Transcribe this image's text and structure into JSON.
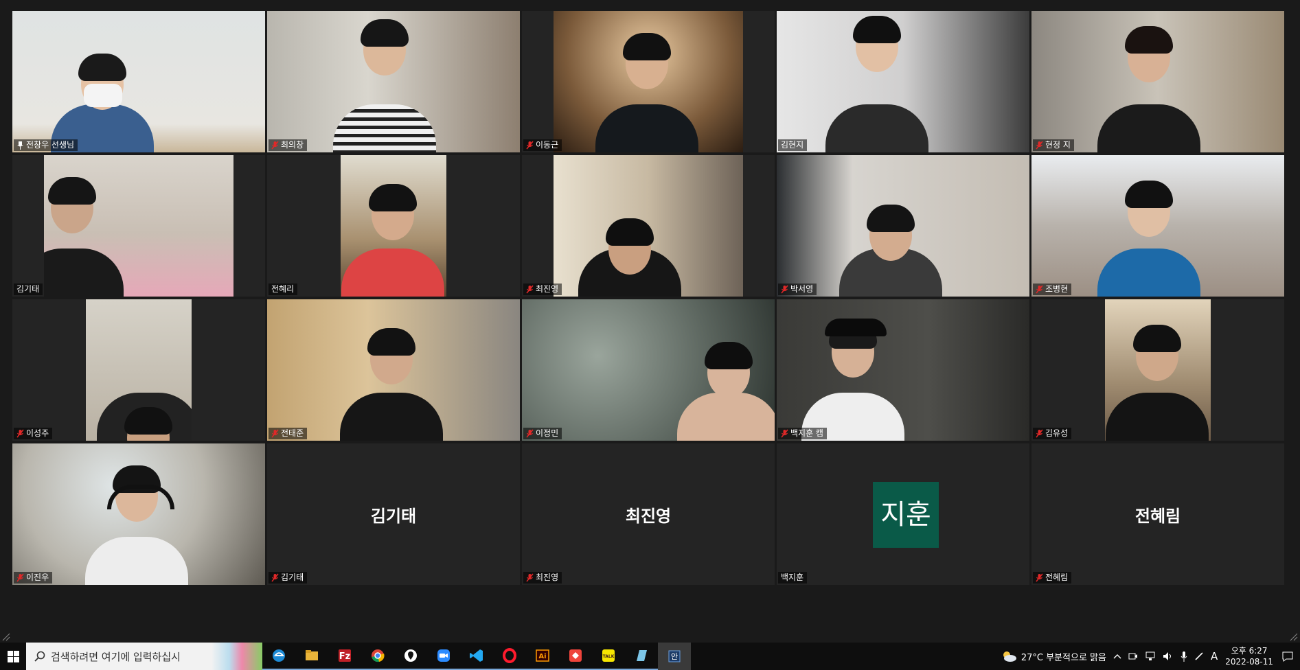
{
  "participants": [
    {
      "name": "전창우 선생님",
      "mic": "pinned",
      "tile": "video",
      "active": true
    },
    {
      "name": "최의창",
      "mic": "muted",
      "tile": "video"
    },
    {
      "name": "이동근",
      "mic": "muted",
      "tile": "video"
    },
    {
      "name": "김현지",
      "mic": "none",
      "tile": "video"
    },
    {
      "name": "현정 지",
      "mic": "muted",
      "tile": "video"
    },
    {
      "name": "김기태",
      "mic": "none",
      "tile": "video"
    },
    {
      "name": "전혜리",
      "mic": "none",
      "tile": "video"
    },
    {
      "name": "최진영",
      "mic": "muted",
      "tile": "video"
    },
    {
      "name": "박서영",
      "mic": "muted",
      "tile": "video"
    },
    {
      "name": "조병현",
      "mic": "muted",
      "tile": "video"
    },
    {
      "name": "이성주",
      "mic": "muted",
      "tile": "video"
    },
    {
      "name": "전태준",
      "mic": "muted",
      "tile": "video"
    },
    {
      "name": "이정민",
      "mic": "muted",
      "tile": "video"
    },
    {
      "name": "백지훈 캠",
      "mic": "muted",
      "tile": "video"
    },
    {
      "name": "김유성",
      "mic": "muted",
      "tile": "video"
    },
    {
      "name": "이진우",
      "mic": "muted",
      "tile": "video"
    },
    {
      "name": "김기태",
      "mic": "muted",
      "tile": "name",
      "display": "김기태"
    },
    {
      "name": "최진영",
      "mic": "muted",
      "tile": "name",
      "display": "최진영"
    },
    {
      "name": "백지훈",
      "mic": "none",
      "tile": "avatar",
      "display": "지훈"
    },
    {
      "name": "전혜림",
      "mic": "muted",
      "tile": "name",
      "display": "전혜림"
    }
  ],
  "taskbar": {
    "search_placeholder": "검색하려면 여기에 입력하십시",
    "apps": [
      {
        "icon": "edge-icon"
      },
      {
        "icon": "file-explorer-icon"
      },
      {
        "icon": "filezilla-icon"
      },
      {
        "icon": "chrome-icon"
      },
      {
        "icon": "maps-pin-icon"
      },
      {
        "icon": "zoom-icon"
      },
      {
        "icon": "vscode-icon"
      },
      {
        "icon": "opera-icon"
      },
      {
        "icon": "illustrator-icon"
      },
      {
        "icon": "anydesk-icon"
      },
      {
        "icon": "kakaotalk-icon"
      },
      {
        "icon": "notes-icon"
      },
      {
        "icon": "ime-icon"
      }
    ],
    "ai_label": "Ai",
    "talk_label": "TALK",
    "ime_label": "안"
  },
  "tray": {
    "weather": "27°C  부분적으로 맑음",
    "ime_mode": "A",
    "time": "오후 6:27",
    "date": "2022-08-11"
  },
  "colors": {
    "stage_bg": "#1a1a1a",
    "tile_bg": "#242424",
    "active_border": "#c8d64a",
    "avatar_bg": "#0a5a48",
    "muted_red": "#e02828"
  }
}
